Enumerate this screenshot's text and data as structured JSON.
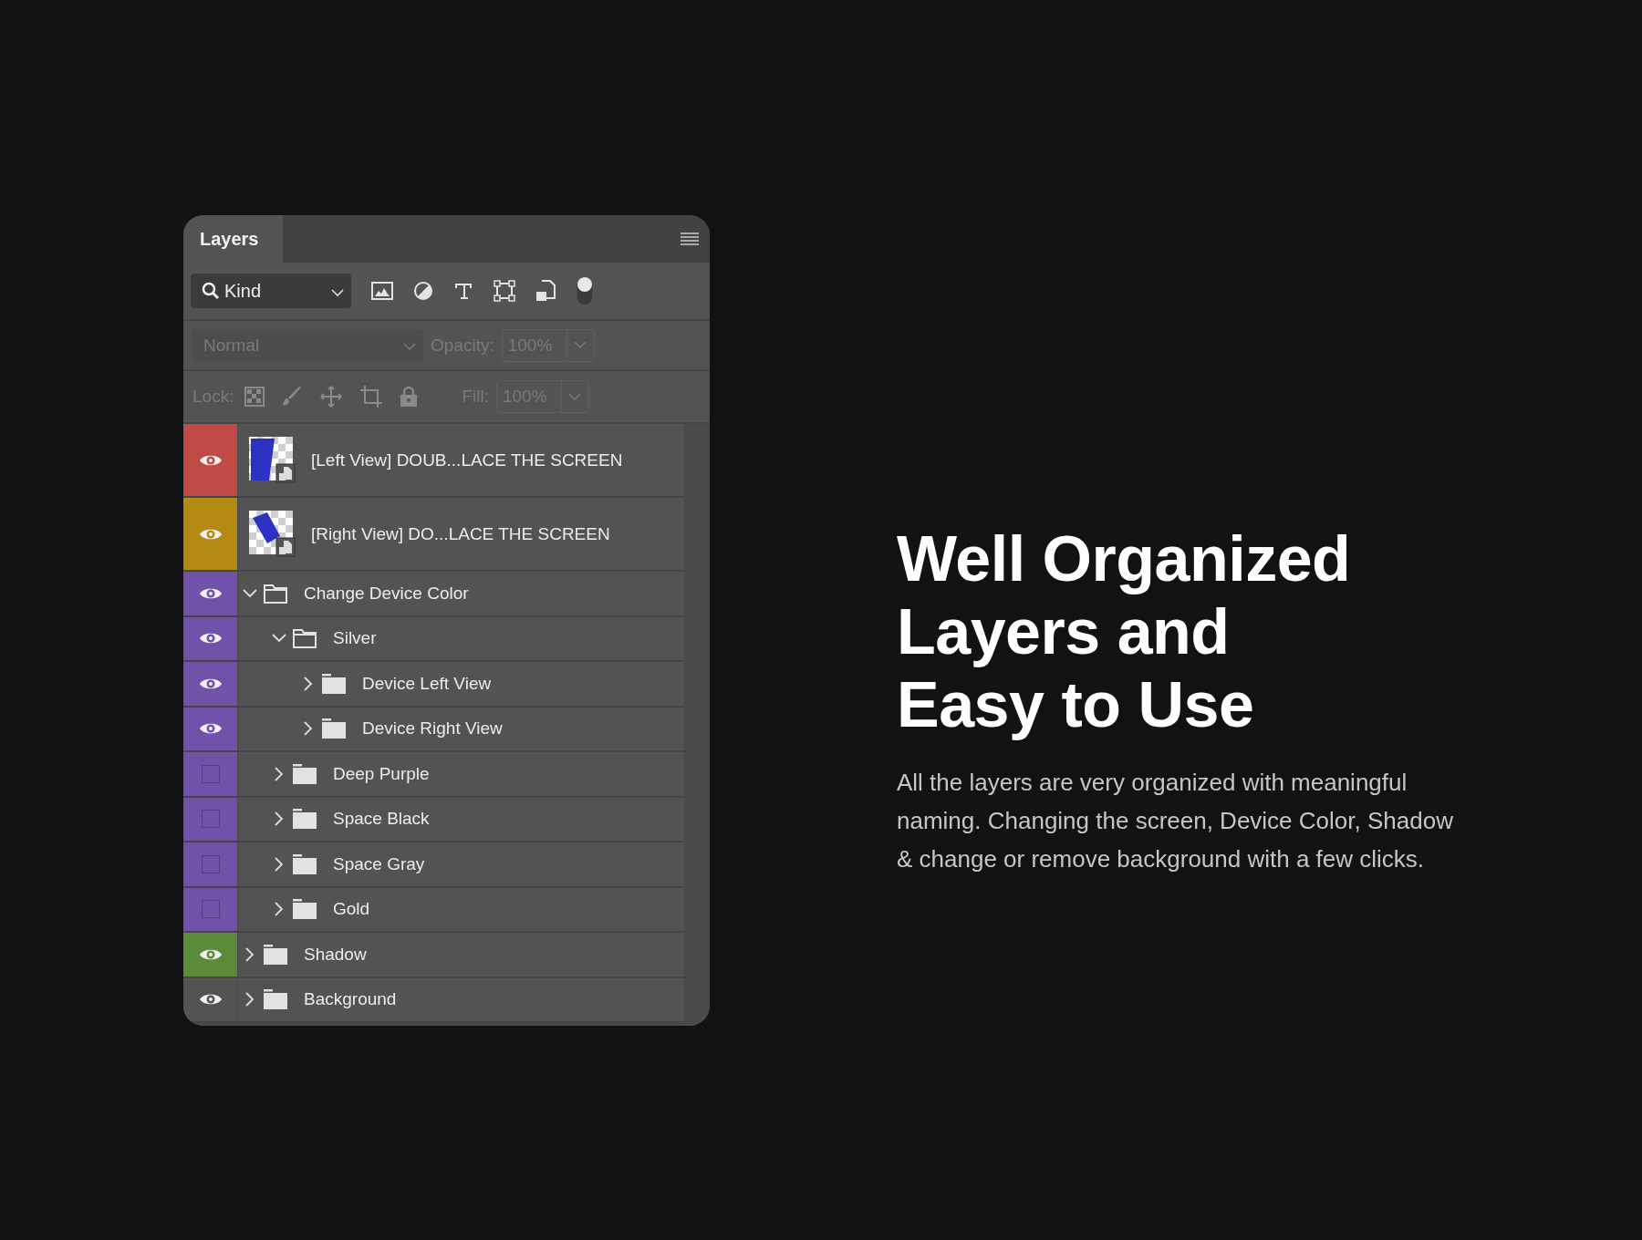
{
  "panel": {
    "tabs": [
      {
        "label": "Layers",
        "selected": true
      }
    ],
    "filter": {
      "kind": "Kind",
      "enabled": true
    },
    "blend": {
      "mode": "Normal",
      "opacity_label": "Opacity:",
      "opacity": "100%",
      "disabled": true
    },
    "lock": {
      "label": "Lock:",
      "fill_label": "Fill:",
      "fill": "100%",
      "disabled": true
    },
    "layers": [
      {
        "kind": "smart",
        "name": "[Left View] DOUB...LACE THE SCREEN",
        "visible": true,
        "color": "#c24a46"
      },
      {
        "kind": "smart",
        "name": "[Right View] DO...LACE THE SCREEN",
        "visible": true,
        "color": "#b38b12"
      },
      {
        "kind": "group",
        "name": "Change Device Color",
        "visible": true,
        "expanded": true,
        "color": "#7152ab",
        "children": [
          {
            "kind": "group",
            "name": "Silver",
            "visible": true,
            "expanded": true,
            "color": "#7152ab",
            "children": [
              {
                "kind": "group",
                "name": "Device Left View",
                "visible": true,
                "expanded": false,
                "color": "#7152ab"
              },
              {
                "kind": "group",
                "name": "Device Right View",
                "visible": true,
                "expanded": false,
                "color": "#7152ab"
              }
            ]
          },
          {
            "kind": "group",
            "name": "Deep Purple",
            "visible": false,
            "expanded": false,
            "color": "#7152ab"
          },
          {
            "kind": "group",
            "name": "Space Black",
            "visible": false,
            "expanded": false,
            "color": "#7152ab"
          },
          {
            "kind": "group",
            "name": "Space Gray",
            "visible": false,
            "expanded": false,
            "color": "#7152ab"
          },
          {
            "kind": "group",
            "name": "Gold",
            "visible": false,
            "expanded": false,
            "color": "#7152ab"
          }
        ]
      },
      {
        "kind": "group",
        "name": "Shadow",
        "visible": true,
        "expanded": false,
        "color": "#5a8a3a"
      },
      {
        "kind": "group",
        "name": "Background",
        "visible": true,
        "expanded": false
      }
    ]
  },
  "headline": [
    "Well Organized",
    "Layers and",
    "Easy to Use"
  ],
  "description": "All the layers are very organized with meaningful naming. Changing the screen, Device Color, Shadow & change or remove background with a few clicks."
}
